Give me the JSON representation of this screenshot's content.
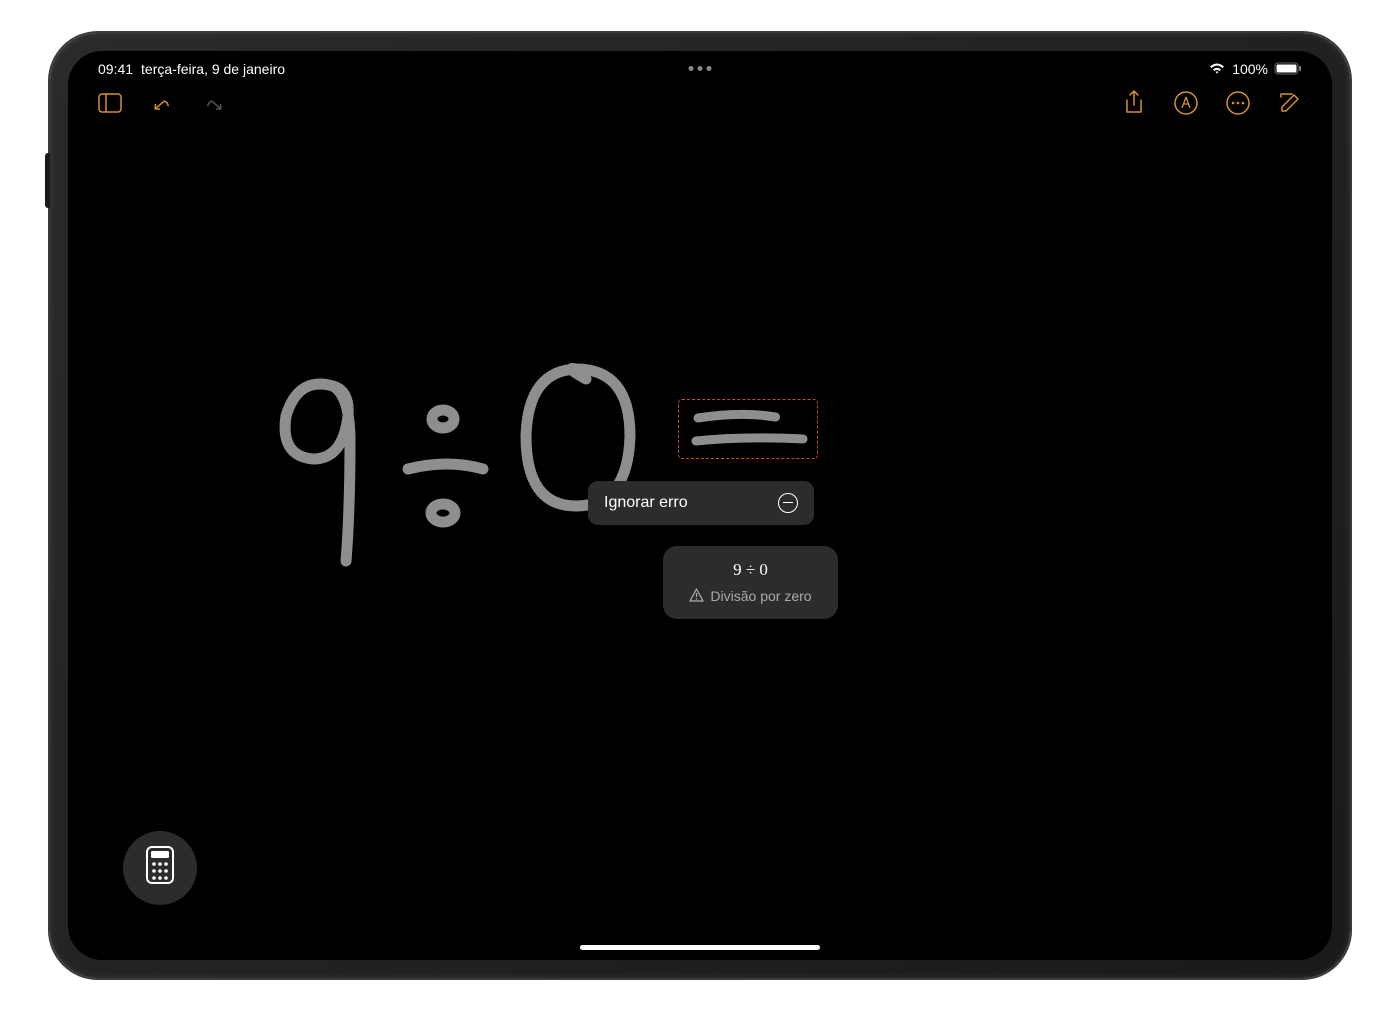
{
  "status_bar": {
    "time": "09:41",
    "date": "terça-feira, 9 de janeiro",
    "battery_percent": "100%"
  },
  "popup": {
    "ignore_label": "Ignorar erro"
  },
  "error_detail": {
    "expression": "9 ÷ 0",
    "message": "Divisão por zero"
  },
  "colors": {
    "accent": "#d49130",
    "error": "#d4442a",
    "handwriting": "#8e8e90"
  }
}
